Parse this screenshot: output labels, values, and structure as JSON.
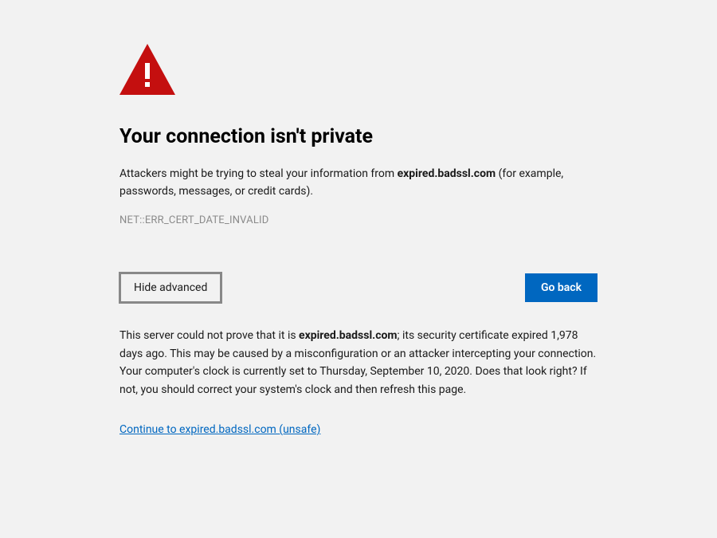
{
  "icon": {
    "name": "warning-triangle",
    "color": "#c40f0f"
  },
  "heading": "Your connection isn't private",
  "warning": {
    "prefix": "Attackers might be trying to steal your information from ",
    "domain": "expired.badssl.com",
    "suffix": " (for example, passwords, messages, or credit cards)."
  },
  "error_code": "NET::ERR_CERT_DATE_INVALID",
  "buttons": {
    "advanced": "Hide advanced",
    "go_back": "Go back"
  },
  "details": {
    "prefix": "This server could not prove that it is ",
    "domain": "expired.badssl.com",
    "suffix": "; its security certificate expired 1,978 days ago. This may be caused by a misconfiguration or an attacker intercepting your connection. Your computer's clock is currently set to Thursday, September 10, 2020. Does that look right? If not, you should correct your system's clock and then refresh this page."
  },
  "continue_link": "Continue to expired.badssl.com (unsafe)"
}
